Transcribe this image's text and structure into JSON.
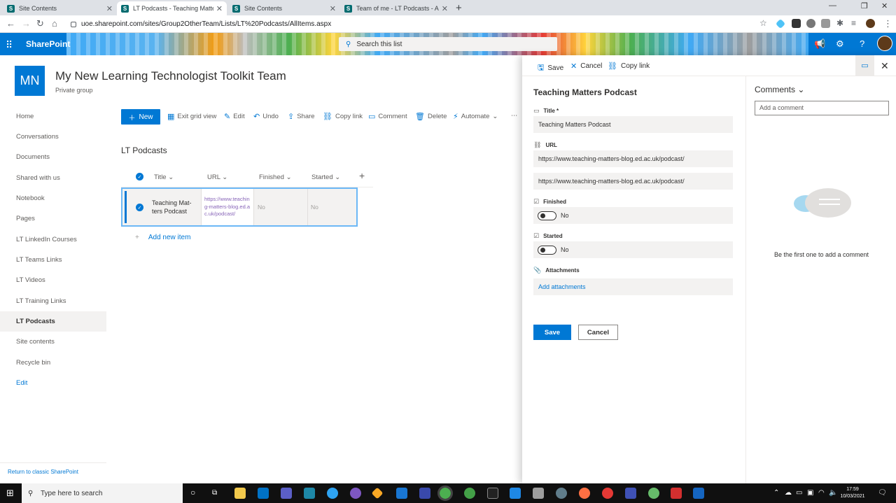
{
  "browser": {
    "tabs": [
      {
        "label": "Site Contents",
        "active": false
      },
      {
        "label": "LT Podcasts - Teaching Matters P",
        "active": true
      },
      {
        "label": "Site Contents",
        "active": false
      },
      {
        "label": "Team of me - LT Podcasts - All It",
        "active": false
      }
    ],
    "url": "uoe.sharepoint.com/sites/Group2OtherTeam/Lists/LT%20Podcasts/AllItems.aspx"
  },
  "suitebar": {
    "app_name": "SharePoint",
    "search_placeholder": "Search this list"
  },
  "site": {
    "logo_initials": "MN",
    "title": "My New Learning Technologist Toolkit Team",
    "subtitle": "Private group"
  },
  "nav": {
    "items": [
      {
        "label": "Home"
      },
      {
        "label": "Conversations"
      },
      {
        "label": "Documents"
      },
      {
        "label": "Shared with us"
      },
      {
        "label": "Notebook"
      },
      {
        "label": "Pages"
      },
      {
        "label": "LT LinkedIn Courses"
      },
      {
        "label": "LT Teams Links"
      },
      {
        "label": "LT Videos"
      },
      {
        "label": "LT Training Links"
      },
      {
        "label": "LT Podcasts"
      },
      {
        "label": "Site contents"
      },
      {
        "label": "Recycle bin"
      },
      {
        "label": "Edit"
      }
    ],
    "selected": "LT Podcasts",
    "classic_link": "Return to classic SharePoint"
  },
  "commandbar": {
    "new": "New",
    "exit_grid": "Exit grid view",
    "edit": "Edit",
    "undo": "Undo",
    "share": "Share",
    "copy_link": "Copy link",
    "comment": "Comment",
    "delete": "Delete",
    "automate": "Automate"
  },
  "list": {
    "title": "LT Podcasts",
    "columns": [
      "Title",
      "URL",
      "Finished",
      "Started"
    ],
    "rows": [
      {
        "title": "Teaching Mat-ters Podcast",
        "url": "https://www.teaching-matters-blog.ed.ac.uk/podcast/",
        "finished": "No",
        "started": "No"
      }
    ],
    "add_new": "Add new item"
  },
  "panel": {
    "save": "Save",
    "cancel": "Cancel",
    "copy_link": "Copy link",
    "item_title": "Teaching Matters Podcast",
    "fields": {
      "title_label": "Title *",
      "title_value": "Teaching Matters Podcast",
      "url_label": "URL",
      "url_value": "https://www.teaching-matters-blog.ed.ac.uk/podcast/",
      "url_description": "https://www.teaching-matters-blog.ed.ac.uk/podcast/",
      "finished_label": "Finished",
      "finished_value": "No",
      "started_label": "Started",
      "started_value": "No",
      "attachments_label": "Attachments",
      "add_attachments": "Add attachments"
    },
    "save_button": "Save",
    "cancel_button": "Cancel"
  },
  "comments": {
    "title": "Comments",
    "placeholder": "Add a comment",
    "empty": "Be the first one to add a comment"
  },
  "taskbar": {
    "search_placeholder": "Type here to search",
    "time": "17:59",
    "date": "10/03/2021"
  },
  "colors": {
    "accent": "#0078d4",
    "suite_bar": "#0078d4",
    "taskbar": "#101010"
  }
}
